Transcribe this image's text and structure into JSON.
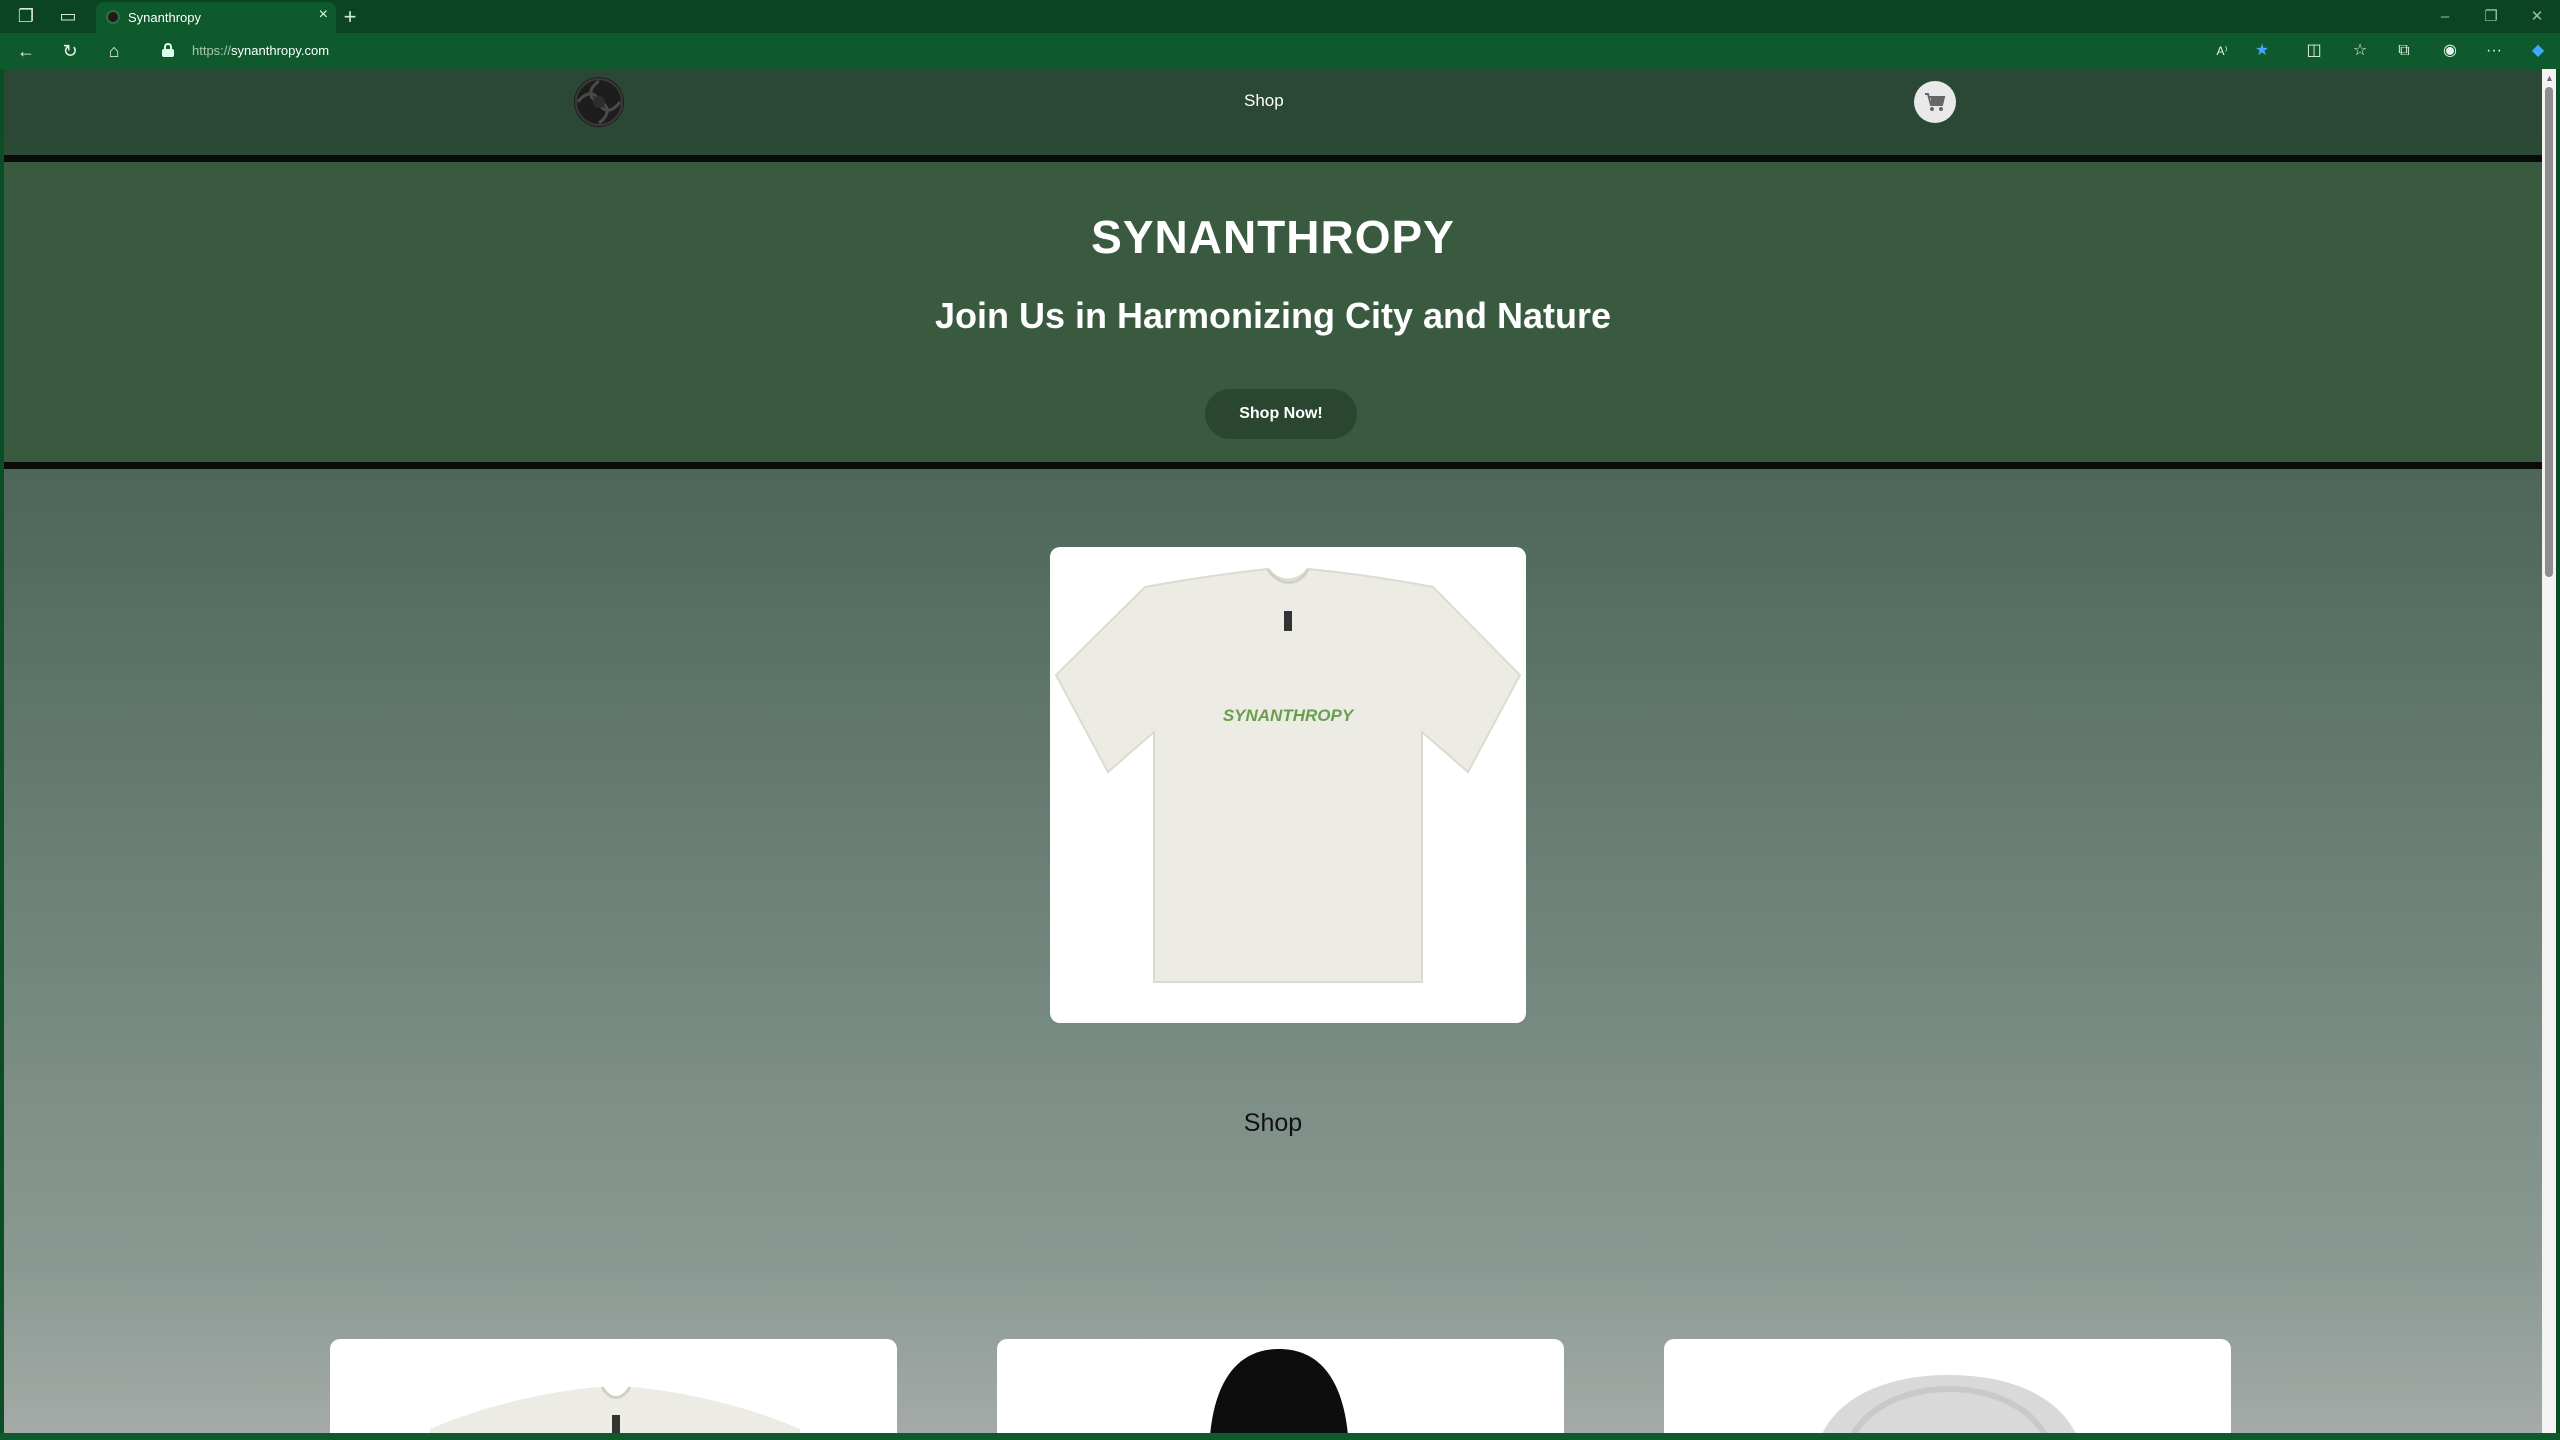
{
  "browser": {
    "tab_title": "Synanthropy",
    "url_scheme": "https://",
    "url_host": "synanthropy.com"
  },
  "header": {
    "nav_link": "Shop"
  },
  "hero": {
    "title": "SYNANTHROPY",
    "subtitle": "Join Us in Harmonizing City and Nature",
    "cta_label": "Shop Now!"
  },
  "featured": {
    "shirt_print": "SYNANTHROPY"
  },
  "shop": {
    "section_title": "Shop"
  },
  "colors": {
    "chrome": "#0f5a2d",
    "header": "#2b4735",
    "hero": "#3a5a40",
    "button": "#2a4631"
  },
  "icons": [
    "tab-actions-icon",
    "tab-list-icon",
    "back-icon",
    "refresh-icon",
    "home-icon",
    "lock-icon",
    "read-aloud-icon",
    "favorite-star-icon",
    "split-screen-icon",
    "favorites-icon",
    "collections-icon",
    "profile-icon",
    "more-icon",
    "copilot-icon",
    "cart-icon"
  ]
}
